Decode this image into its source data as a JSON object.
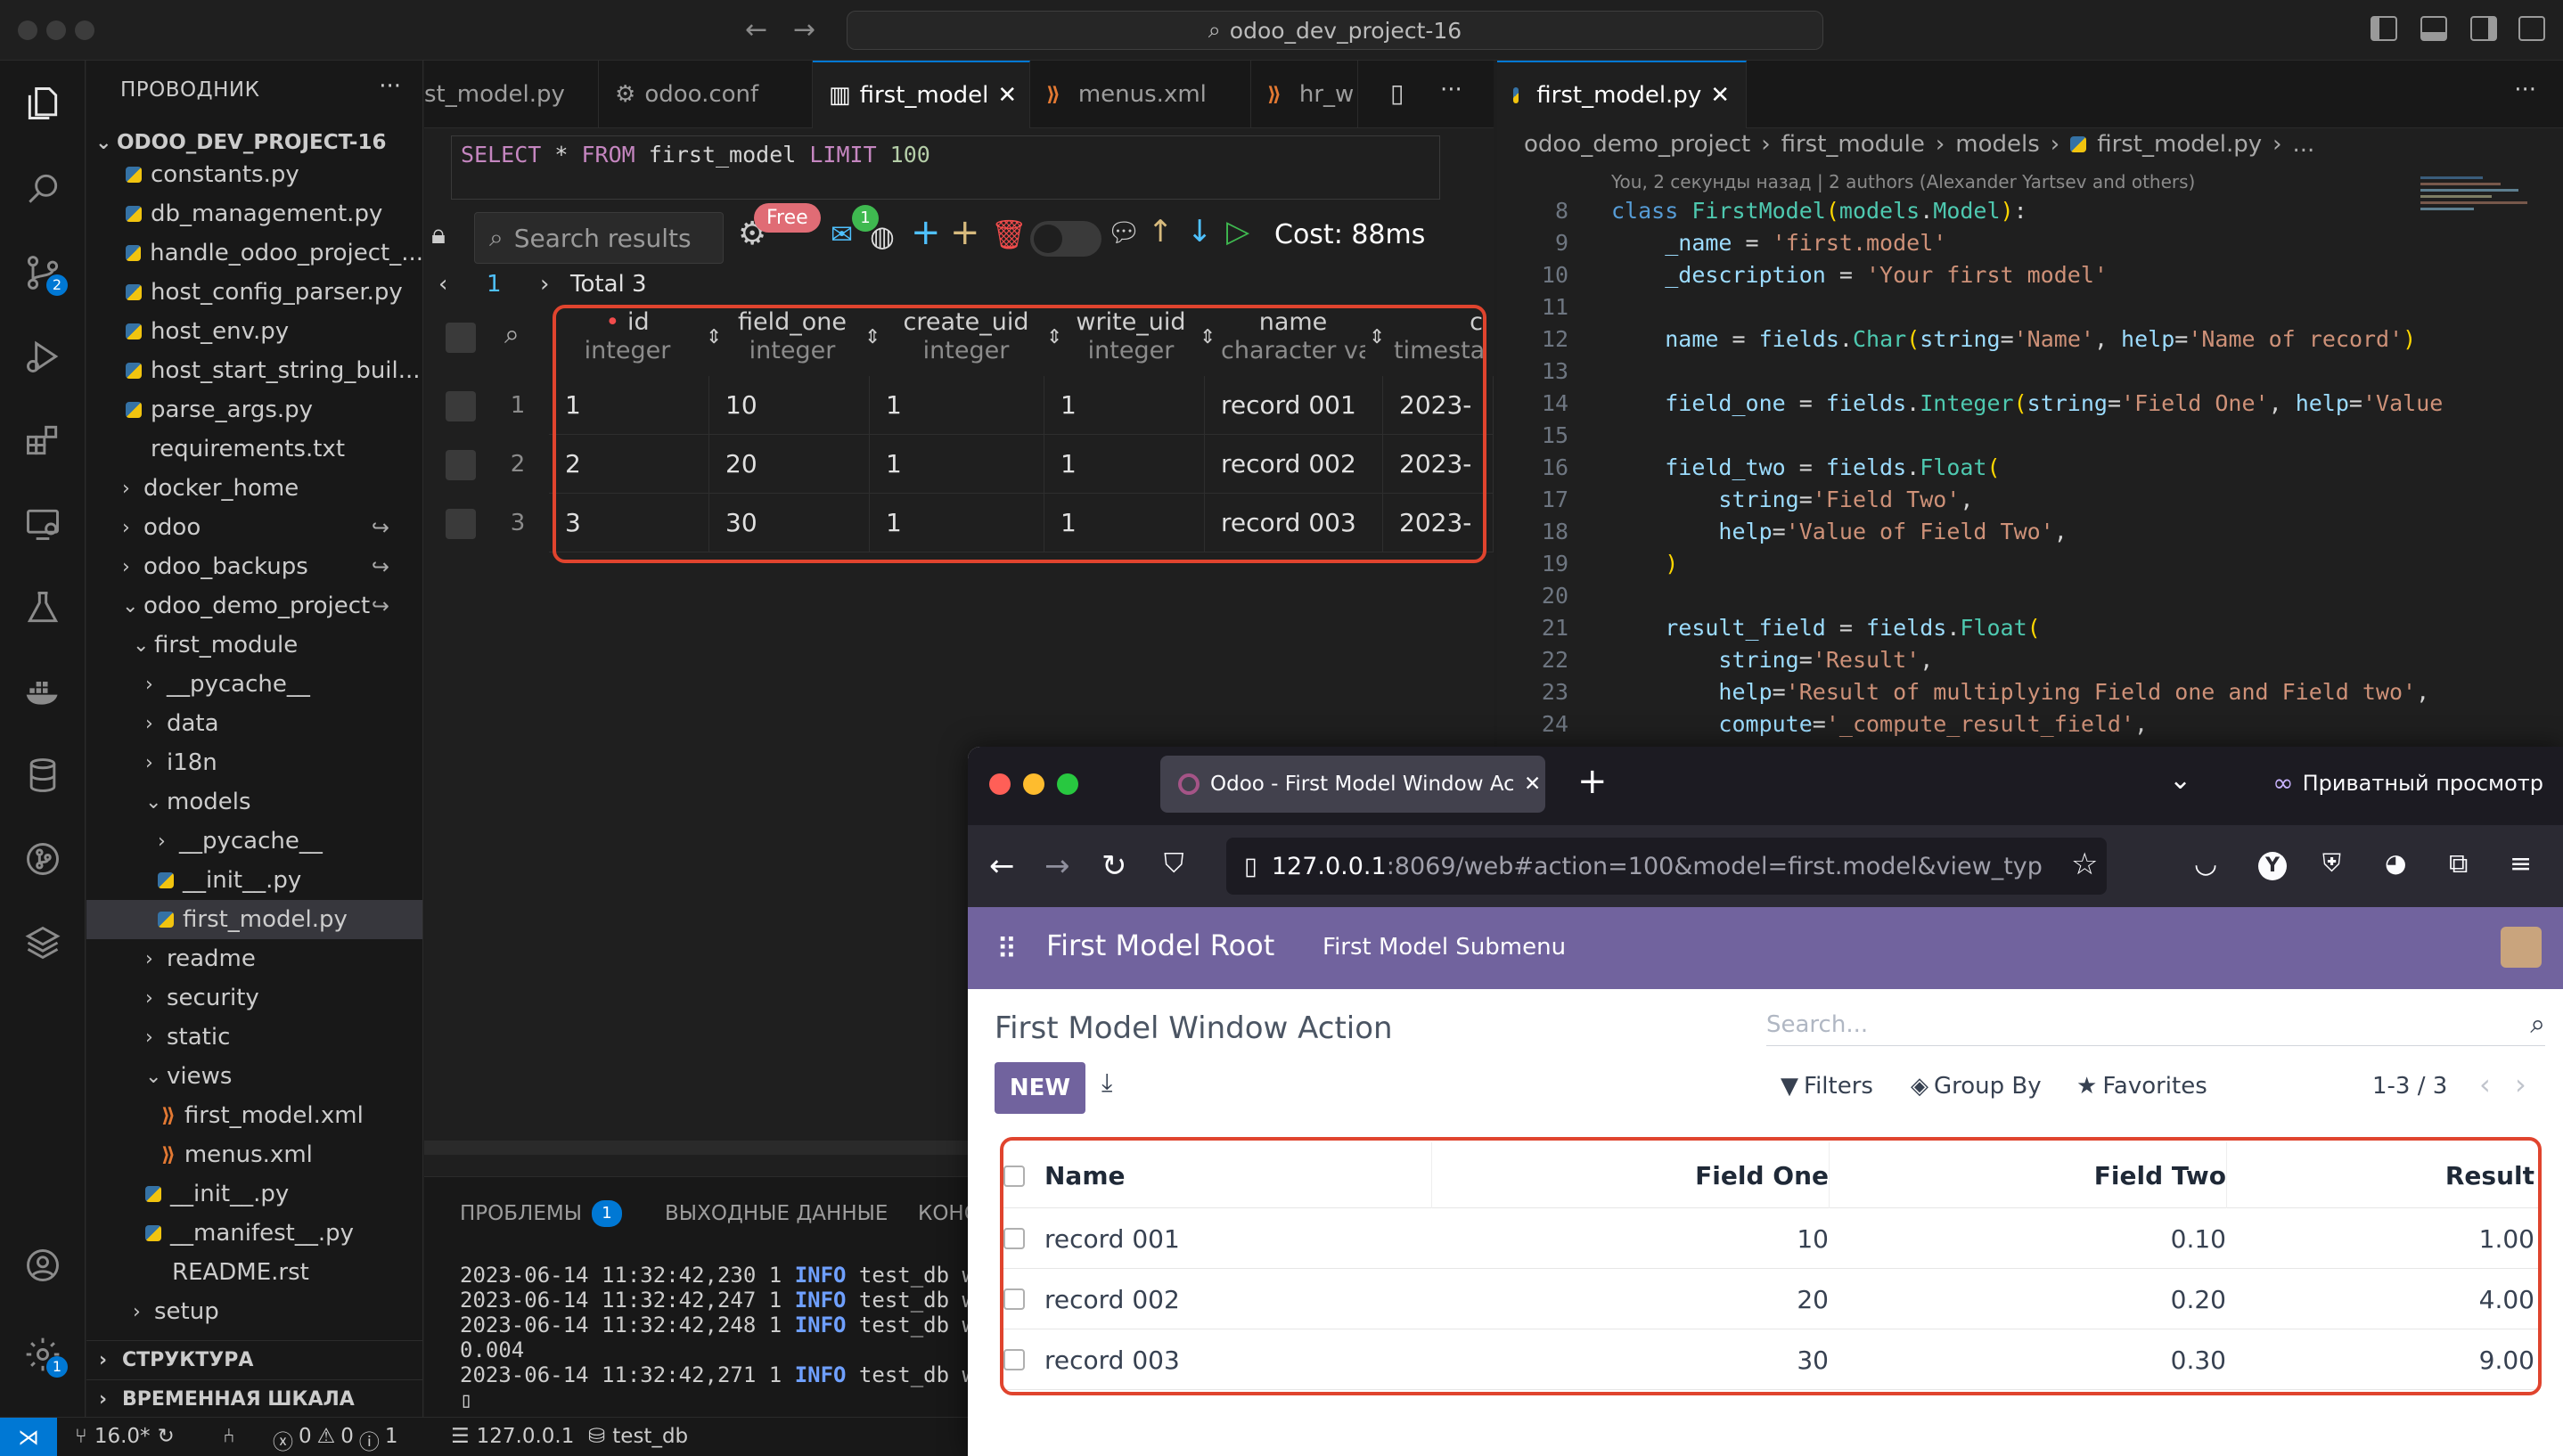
{
  "titlebar": {
    "project_search": "odoo_dev_project-16"
  },
  "sidebar": {
    "title": "ПРОВОДНИК",
    "root": "ODOO_DEV_PROJECT-16",
    "items": [
      {
        "label": "constants.py",
        "kind": "py"
      },
      {
        "label": "db_management.py",
        "kind": "py"
      },
      {
        "label": "handle_odoo_project_...",
        "kind": "py"
      },
      {
        "label": "host_config_parser.py",
        "kind": "py"
      },
      {
        "label": "host_env.py",
        "kind": "py"
      },
      {
        "label": "host_start_string_buil...",
        "kind": "py"
      },
      {
        "label": "parse_args.py",
        "kind": "py"
      },
      {
        "label": "requirements.txt",
        "kind": "txt"
      },
      {
        "label": "docker_home",
        "kind": "folder"
      },
      {
        "label": "odoo",
        "kind": "folder-link"
      },
      {
        "label": "odoo_backups",
        "kind": "folder-link"
      },
      {
        "label": "odoo_demo_project",
        "kind": "folder-open-link"
      },
      {
        "label": "first_module",
        "kind": "folder-open"
      },
      {
        "label": "__pycache__",
        "kind": "folder"
      },
      {
        "label": "data",
        "kind": "folder"
      },
      {
        "label": "i18n",
        "kind": "folder"
      },
      {
        "label": "models",
        "kind": "folder-open"
      },
      {
        "label": "__pycache__",
        "kind": "folder"
      },
      {
        "label": "__init__.py",
        "kind": "py"
      },
      {
        "label": "first_model.py",
        "kind": "py"
      },
      {
        "label": "readme",
        "kind": "folder"
      },
      {
        "label": "security",
        "kind": "folder"
      },
      {
        "label": "static",
        "kind": "folder"
      },
      {
        "label": "views",
        "kind": "folder-open"
      },
      {
        "label": "first_model.xml",
        "kind": "xml"
      },
      {
        "label": "menus.xml",
        "kind": "xml"
      },
      {
        "label": "__init__.py",
        "kind": "py"
      },
      {
        "label": "__manifest__.py",
        "kind": "py"
      },
      {
        "label": "README.rst",
        "kind": "txt"
      },
      {
        "label": "setup",
        "kind": "folder"
      }
    ],
    "section_structure": "СТРУКТУРА",
    "section_timeline": "ВРЕМЕННАЯ ШКАЛА"
  },
  "tabs_left": [
    {
      "label": "st_model.py"
    },
    {
      "label": "odoo.conf"
    },
    {
      "label": "first_model"
    },
    {
      "label": "menus.xml"
    },
    {
      "label": "hr_w"
    }
  ],
  "tabs_right": [
    {
      "label": "first_model.py"
    }
  ],
  "sql": {
    "query_kw1": "SELECT",
    "query_star": " * ",
    "query_kw2": "FROM",
    "query_table": " first_model ",
    "query_kw3": "LIMIT",
    "query_limit": " 100",
    "search_placeholder": "Search results",
    "free_badge": "Free",
    "mail_badge": "1",
    "cost": "Cost: 88ms",
    "page": "1",
    "total": "Total 3",
    "columns": [
      {
        "name": "id",
        "type": "integer"
      },
      {
        "name": "field_one",
        "type": "integer"
      },
      {
        "name": "create_uid",
        "type": "integer"
      },
      {
        "name": "write_uid",
        "type": "integer"
      },
      {
        "name": "name",
        "type": "character va"
      },
      {
        "name": "c",
        "type": "timesta"
      }
    ],
    "rows": [
      {
        "num": "1",
        "id": "1",
        "field_one": "10",
        "create_uid": "1",
        "write_uid": "1",
        "name": "record 001",
        "c": "2023-"
      },
      {
        "num": "2",
        "id": "2",
        "field_one": "20",
        "create_uid": "1",
        "write_uid": "1",
        "name": "record 002",
        "c": "2023-"
      },
      {
        "num": "3",
        "id": "3",
        "field_one": "30",
        "create_uid": "1",
        "write_uid": "1",
        "name": "record 003",
        "c": "2023-"
      }
    ]
  },
  "panel": {
    "tab_problems": "ПРОБЛЕМЫ",
    "problems_count": "1",
    "tab_output": "ВЫХОДНЫЕ ДАННЫЕ",
    "tab_console": "КОНС",
    "logs": [
      {
        "prefix": "2023-06-14 11:32:42,230 1 ",
        "level": "INFO",
        "suffix": " test_db we"
      },
      {
        "prefix": "2023-06-14 11:32:42,247 1 ",
        "level": "INFO",
        "suffix": " test_db we"
      },
      {
        "prefix": "2023-06-14 11:32:42,248 1 ",
        "level": "INFO",
        "suffix": " test_db we"
      },
      {
        "prefix": "0.004",
        "level": "",
        "suffix": ""
      },
      {
        "prefix": "2023-06-14 11:32:42,271 1 ",
        "level": "INFO",
        "suffix": " test_db we"
      }
    ]
  },
  "editor": {
    "breadcrumbs": [
      "odoo_demo_project",
      "first_module",
      "models",
      "first_model.py",
      "..."
    ],
    "blame": "You, 2 секунды назад | 2 authors (Alexander Yartsev and others)"
  },
  "statusbar": {
    "branch": "16.0*",
    "errors": "0",
    "warnings": "0",
    "info": "1",
    "host": "127.0.0.1",
    "db": "test_db"
  },
  "browser": {
    "tab_title": "Odoo - First Model Window Acti",
    "private_label": "Приватный просмотр",
    "url_host": "127.0.0.1",
    "url_rest": ":8069/web#action=100&model=first.model&view_typ"
  },
  "odoo": {
    "app_title": "First Model Root",
    "menu_submenu": "First Model Submenu",
    "breadcrumb": "First Model Window Action",
    "search_placeholder": "Search...",
    "new_button": "NEW",
    "filters": "Filters",
    "group_by": "Group By",
    "favorites": "Favorites",
    "pager": "1-3 / 3",
    "columns": [
      "Name",
      "Field One",
      "Field Two",
      "Result"
    ],
    "rows": [
      {
        "name": "record 001",
        "field_one": "10",
        "field_two": "0.10",
        "result": "1.00"
      },
      {
        "name": "record 002",
        "field_one": "20",
        "field_two": "0.20",
        "result": "4.00"
      },
      {
        "name": "record 003",
        "field_one": "30",
        "field_two": "0.30",
        "result": "9.00"
      }
    ]
  }
}
